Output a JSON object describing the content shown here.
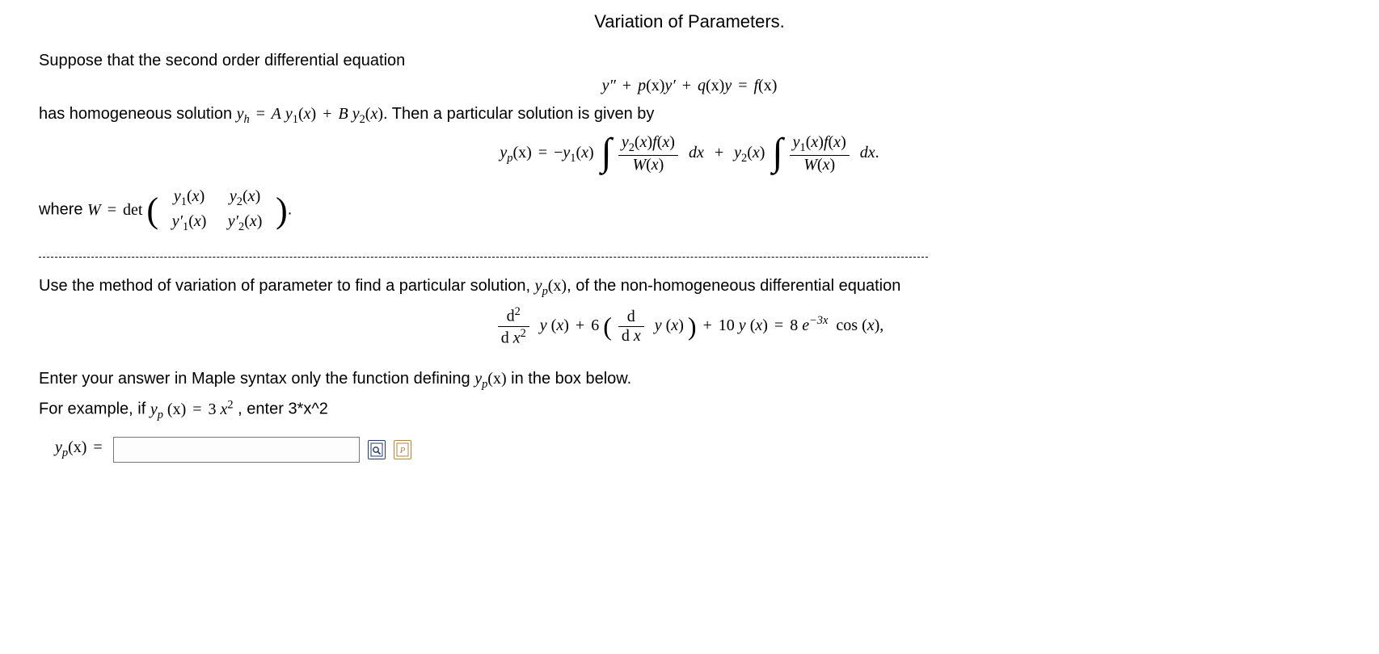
{
  "title": "Variation of Parameters.",
  "intro": "Suppose that the second order differential equation",
  "ode": {
    "lhs1": "y″",
    "op1": "+",
    "p": "p",
    "xarg": "(x)",
    "yprime": "y′",
    "op2": "+",
    "q": "q",
    "y": "y",
    "eq": "=",
    "f": "f"
  },
  "hom": {
    "pre": "has homogeneous solution ",
    "yh": "y",
    "hsub": "h",
    "eq": "=",
    "A": "A",
    "y1": "y",
    "sub1": "1",
    "B": "B",
    "y2": "y",
    "sub2": "2",
    "post": ". Then a particular solution is given by"
  },
  "yp_formula": {
    "ylabel": "y",
    "psub": "p",
    "arg": "(x)",
    "eq": "=",
    "neg": "−",
    "f": "f",
    "W": "W",
    "int": "∫",
    "dx": "dx",
    "plus": "+",
    "dot": "."
  },
  "wronskian": {
    "pre": "where ",
    "W": "W",
    "eq": "=",
    "det": "det",
    "m11": "y₁(x)",
    "m12": "y₂(x)",
    "m21": "y′₁(x)",
    "m22": "y′₂(x)",
    "dot": "."
  },
  "task": {
    "pre": "Use the method of variation of parameter to find a particular solution, ",
    "yplabel": "y",
    "psub": "p",
    "arg": "(x)",
    "post": ", of the non-homogeneous differential equation"
  },
  "task_ode": {
    "d2num": "d",
    "d2sup": "2",
    "d2den_d": "d",
    "xvar": "x",
    "y": "y",
    "plus1": "+",
    "c1": "6",
    "dnum": "d",
    "dden": "d x",
    "plus2": "+",
    "c2": "10",
    "eq": "=",
    "rhs_c": "8",
    "e": "e",
    "exp": "−3x",
    "cos": "cos",
    "comma": ","
  },
  "instr1": {
    "pre": "Enter your answer in Maple syntax only the function defining ",
    "yplabel": "y",
    "psub": "p",
    "arg": "(x)",
    "post": "  in the box below."
  },
  "instr2": {
    "pre": "For example, if ",
    "yplabel": "y",
    "psub": "p",
    "arg": "(x)",
    "eq": "=",
    "ex_rhs": "3 x",
    "ex_sup": "2",
    "mid": " , enter ",
    "ex_code": "3*x^2"
  },
  "answer": {
    "label_y": "y",
    "label_sub": "p",
    "label_arg": "(x)",
    "label_eq": "=",
    "value": "",
    "placeholder": ""
  }
}
